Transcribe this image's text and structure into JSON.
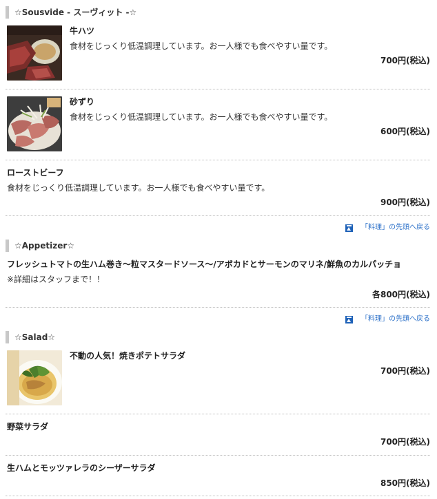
{
  "sections": [
    {
      "heading": "☆Sousvide - スーヴィット -☆",
      "items": [
        {
          "name": "牛ハツ",
          "desc": "食材をじっくり低温調理しています。お一人様でも食べやすい量です。",
          "price": "700円(税込)",
          "photo": "beef-heart-photo"
        },
        {
          "name": "砂ずり",
          "desc": "食材をじっくり低温調理しています。お一人様でも食べやすい量です。",
          "price": "600円(税込)",
          "photo": "gizzard-photo"
        },
        {
          "name": "ローストビーフ",
          "desc": "食材をじっくり低温調理しています。お一人様でも食べやすい量です。",
          "price": "900円(税込)"
        }
      ],
      "back_to_top": "「料理」の先頭へ戻る"
    },
    {
      "heading": "☆Appetizer☆",
      "items": [
        {
          "name": "フレッシュトマトの生ハム巻き～粒マスタードソース～/アボカドとサーモンのマリネ/鮮魚のカルパッチョ",
          "desc": "※詳細はスタッフまで！！",
          "price": "各800円(税込)"
        }
      ],
      "back_to_top": "「料理」の先頭へ戻る"
    },
    {
      "heading": "☆Salad☆",
      "items": [
        {
          "name": "不動の人気！焼きポテトサラダ",
          "price": "700円(税込)",
          "photo": "potato-salad-photo"
        },
        {
          "name": "野菜サラダ",
          "price": "700円(税込)"
        },
        {
          "name": "生ハムとモッツァレラのシーザーサラダ",
          "price": "850円(税込)"
        }
      ]
    }
  ],
  "colors": {
    "link": "#2a6fc8",
    "icon": "#1f62b8",
    "heading_bar": "#c8c8c8"
  }
}
